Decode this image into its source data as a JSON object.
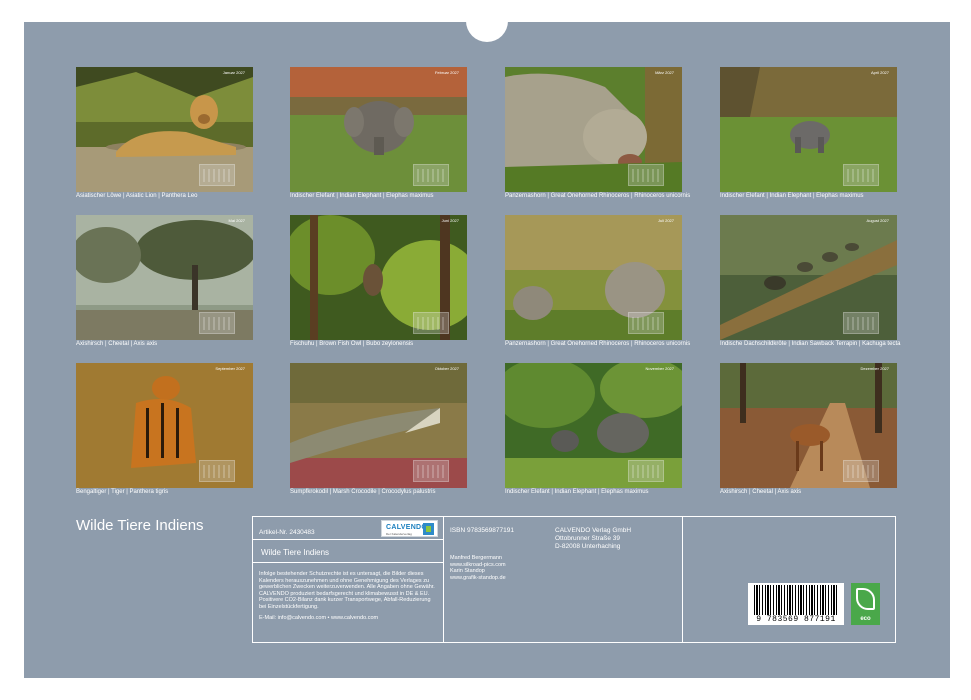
{
  "calendar": {
    "title": "Wilde Tiere Indiens",
    "months": [
      {
        "tag": "Januar 2027",
        "caption": "Asiatischer Löwe | Asiatic Lion | Panthera Leo"
      },
      {
        "tag": "Februar 2027",
        "caption": "Indischer Elefant | Indian Elephant | Elephas maximus"
      },
      {
        "tag": "März 2027",
        "caption": "Panzernashorn | Great Onehorned Rhinoceros | Rhinoceros unicornis"
      },
      {
        "tag": "April 2027",
        "caption": "Indischer Elefant | Indian Elephant | Elephas maximus"
      },
      {
        "tag": "Mai 2027",
        "caption": "Axishirsch | Cheetal | Axis axis"
      },
      {
        "tag": "Juni 2027",
        "caption": "Fischuhu | Brown Fish Owl | Bubo zeylonensis"
      },
      {
        "tag": "Juli 2027",
        "caption": "Panzernashorn | Great Onehorned Rhinoceros | Rhinoceros unicornis"
      },
      {
        "tag": "August 2027",
        "caption": "Indische Dachschildkröte | Indian Sawback Terrapin | Kachuga tecta"
      },
      {
        "tag": "September 2027",
        "caption": "Bengaltiger | Tiger | Panthera tigris"
      },
      {
        "tag": "Oktober 2027",
        "caption": "Sumpfkrokodil | Marsh Crocodile | Crocodylus palustris"
      },
      {
        "tag": "November 2027",
        "caption": "Indischer Elefant | Indian Elephant | Elephas maximus"
      },
      {
        "tag": "Dezember 2027",
        "caption": "Axishirsch | Cheetal | Axis axis"
      }
    ]
  },
  "info": {
    "article": "Artikel-Nr. 2430483",
    "logo_text": "CALVENDO",
    "logo_sub": "Der Kalenderverlag",
    "product_title": "Wilde Tiere Indiens",
    "legal": "Infolge bestehender Schutzrechte ist es untersagt, die Bilder dieses Kalenders herauszunehmen und ohne Genehmigung des Verlages zu gewerblichen Zwecken weiterzuverwenden. Alle Angaben ohne Gewähr. CALVENDO produziert bedarfsgerecht und klimabewusst in DE & EU. Positivere CO2-Bilanz dank kurzer Transportwege, Abfall-Reduzierung bei Einzelstückfertigung.",
    "email": "E-Mail: info@calvendo.com • www.calvendo.com",
    "isbn": "ISBN 9783569877191",
    "publisher_name": "CALVENDO Verlag GmbH",
    "publisher_street": "Ottobrunner Straße 39",
    "publisher_city": "D-82008 Unterhaching",
    "author1": "Manfred Bergermann",
    "author1_web": "www.silkroad-pics.com",
    "author2": "Karin Standop",
    "author2_web": "www.grafik-standop.de"
  },
  "barcode": {
    "number": "9 783569 877191"
  },
  "eco_label": "eco"
}
